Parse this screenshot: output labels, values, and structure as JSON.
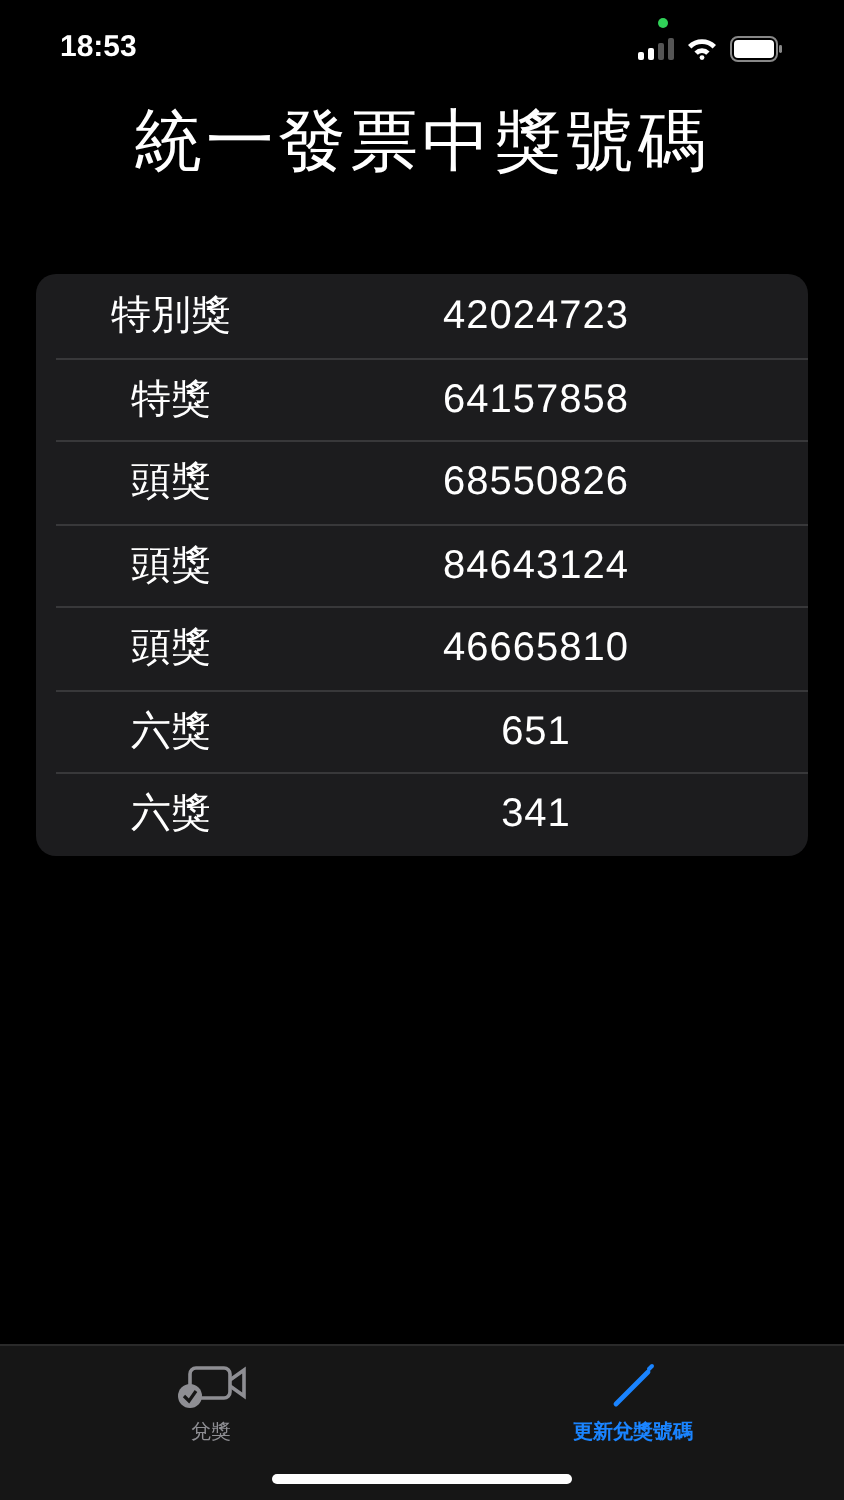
{
  "status_bar": {
    "time": "18:53"
  },
  "title": "統一發票中獎號碼",
  "prizes": [
    {
      "name": "特別獎",
      "number": "42024723"
    },
    {
      "name": "特獎",
      "number": "64157858"
    },
    {
      "name": "頭獎",
      "number": "68550826"
    },
    {
      "name": "頭獎",
      "number": "84643124"
    },
    {
      "name": "頭獎",
      "number": "46665810"
    },
    {
      "name": "六獎",
      "number": "651"
    },
    {
      "name": "六獎",
      "number": "341"
    }
  ],
  "tabs": [
    {
      "label": "兌獎",
      "kind": "camera",
      "selected": false
    },
    {
      "label": "更新兌獎號碼",
      "kind": "pencil",
      "selected": true
    }
  ]
}
